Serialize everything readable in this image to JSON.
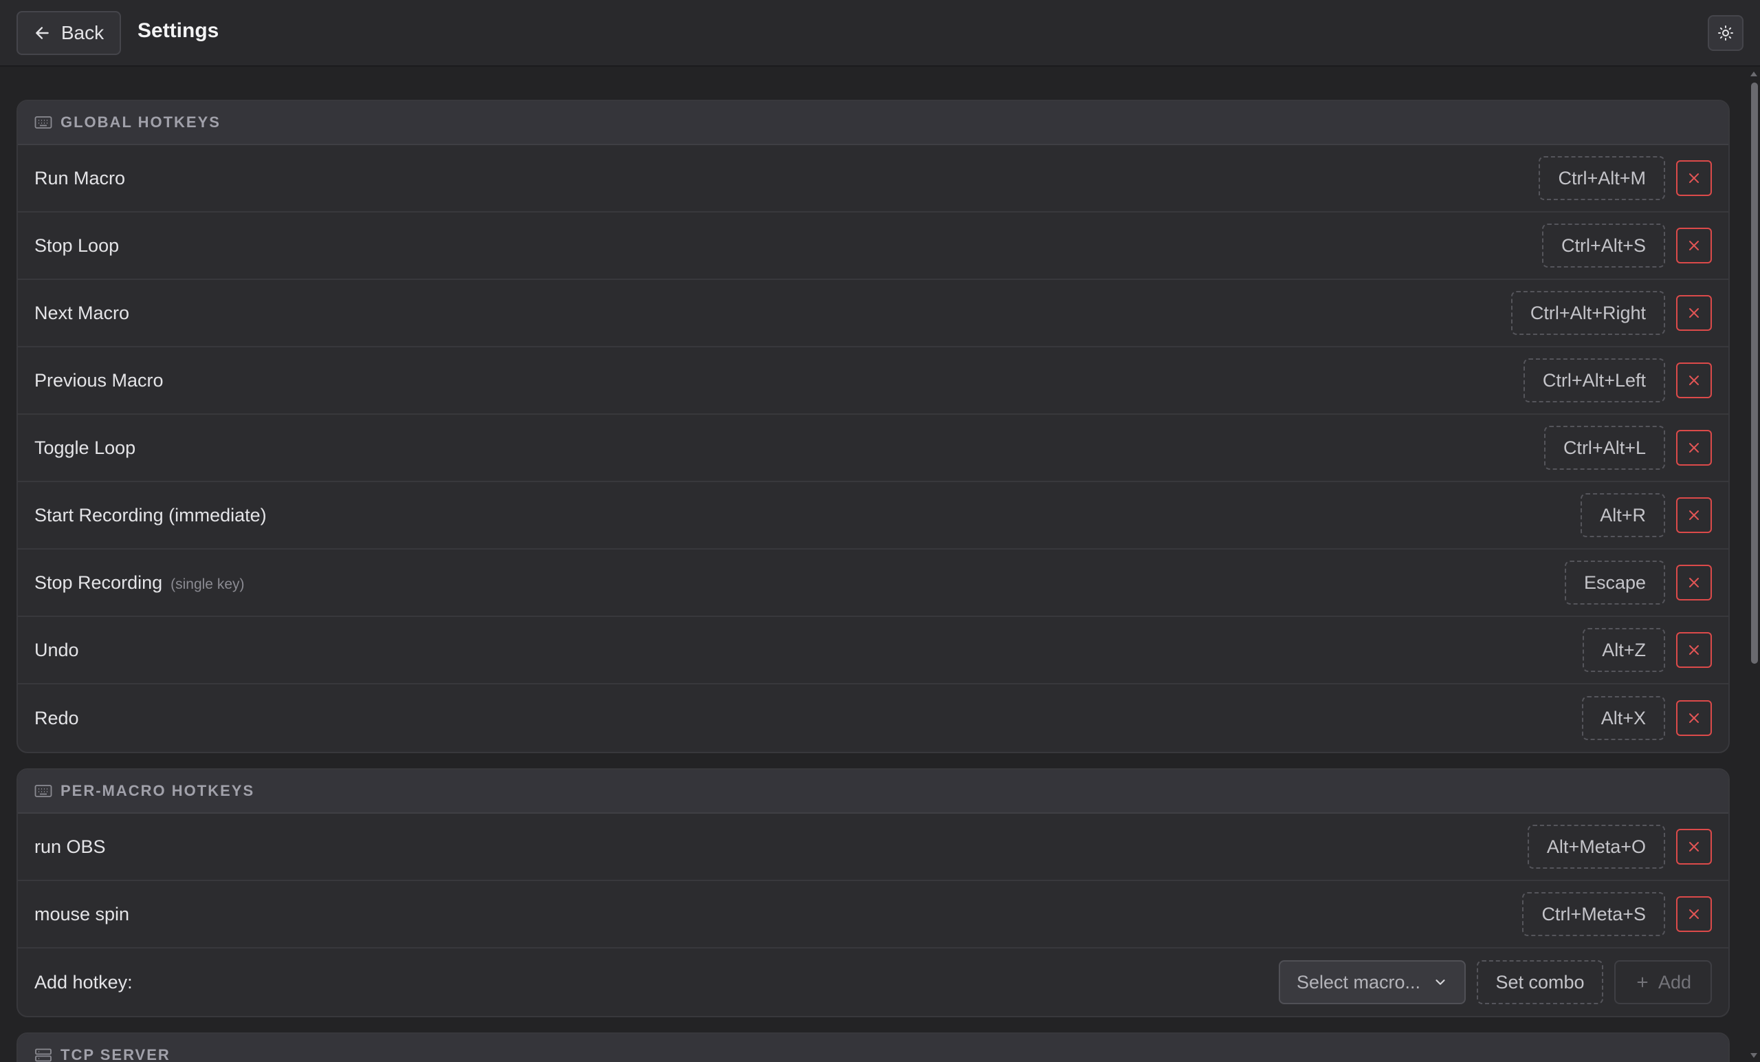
{
  "header": {
    "back_label": "Back",
    "title": "Settings"
  },
  "global": {
    "title": "GLOBAL HOTKEYS",
    "rows": [
      {
        "label": "Run Macro",
        "hint": "",
        "combo": "Ctrl+Alt+M"
      },
      {
        "label": "Stop Loop",
        "hint": "",
        "combo": "Ctrl+Alt+S"
      },
      {
        "label": "Next Macro",
        "hint": "",
        "combo": "Ctrl+Alt+Right"
      },
      {
        "label": "Previous Macro",
        "hint": "",
        "combo": "Ctrl+Alt+Left"
      },
      {
        "label": "Toggle Loop",
        "hint": "",
        "combo": "Ctrl+Alt+L"
      },
      {
        "label": "Start Recording (immediate)",
        "hint": "",
        "combo": "Alt+R"
      },
      {
        "label": "Stop Recording",
        "hint": "(single key)",
        "combo": "Escape"
      },
      {
        "label": "Undo",
        "hint": "",
        "combo": "Alt+Z"
      },
      {
        "label": "Redo",
        "hint": "",
        "combo": "Alt+X"
      }
    ]
  },
  "per_macro": {
    "title": "PER-MACRO HOTKEYS",
    "rows": [
      {
        "label": "run OBS",
        "combo": "Alt+Meta+O"
      },
      {
        "label": "mouse spin",
        "combo": "Ctrl+Meta+S"
      }
    ],
    "add": {
      "label": "Add hotkey:",
      "select_placeholder": "Select macro...",
      "set_combo_label": "Set combo",
      "add_label": "Add"
    }
  },
  "tcp": {
    "title": "TCP SERVER"
  },
  "icons": {
    "back": "arrow-left-icon",
    "theme": "sun-icon",
    "keyboard": "keyboard-icon",
    "server": "server-icon",
    "remove": "x-icon",
    "chevron": "chevron-down-icon",
    "plus": "plus-icon"
  },
  "colors": {
    "background": "#232325",
    "card": "#2c2c2f",
    "danger": "#dc4a4a"
  }
}
